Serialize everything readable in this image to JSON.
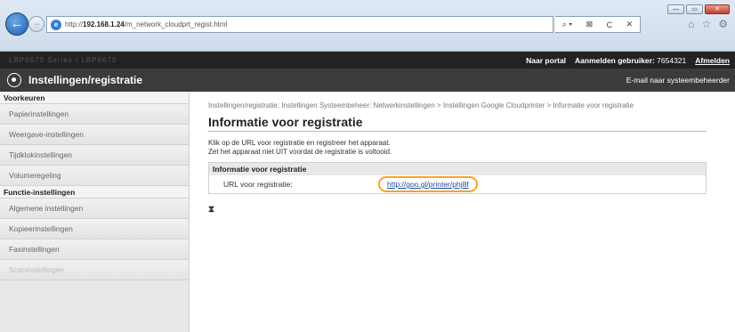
{
  "browser": {
    "url_prefix": "http://",
    "url_host": "192.168.1.24",
    "url_path": "/m_network_cloudprt_regist.html",
    "address_tools": [
      "⌕ ▾",
      "⊠",
      "C",
      "✕"
    ],
    "window_buttons": [
      "—",
      "▭",
      "✕"
    ],
    "toolbar_icons": [
      "⌂",
      "☆",
      "⚙"
    ]
  },
  "header": {
    "model": "LBP6670 Series / LBP6670",
    "portal_link": "Naar portal",
    "login_label": "Aanmelden gebruiker:",
    "login_user": "7654321",
    "logout_link": "Afmelden",
    "app_title": "Instellingen/registratie",
    "admin_mail": "E-mail naar systeembeheerder"
  },
  "sidebar": {
    "section1": "Voorkeuren",
    "items1": [
      "Papierinstellingen",
      "Weergave-instellingen",
      "Tijdklokinstellingen",
      "Volumeregeling"
    ],
    "section2": "Functie-instellingen",
    "items2": [
      "Algemene instellingen",
      "Kopieerinstellingen",
      "Faxinstellingen",
      "Scaninstellingen"
    ]
  },
  "main": {
    "breadcrumb": "Instellingen/registratie: Instellingen Systeembeheer: Netwerkinstellingen > Instellingen Google Cloudprinter > Informatie voor registratie",
    "title": "Informatie voor registratie",
    "desc1": "Klik op de URL voor registratie en registreer het apparaat.",
    "desc2": "Zet het apparaat niet UIT voordat de registratie is voltooid.",
    "box_heading": "Informatie voor registratie",
    "url_label": "URL voor registratie:",
    "url_value": "http://goo.gl/printer/phj8f",
    "top_icon": "⧗"
  }
}
